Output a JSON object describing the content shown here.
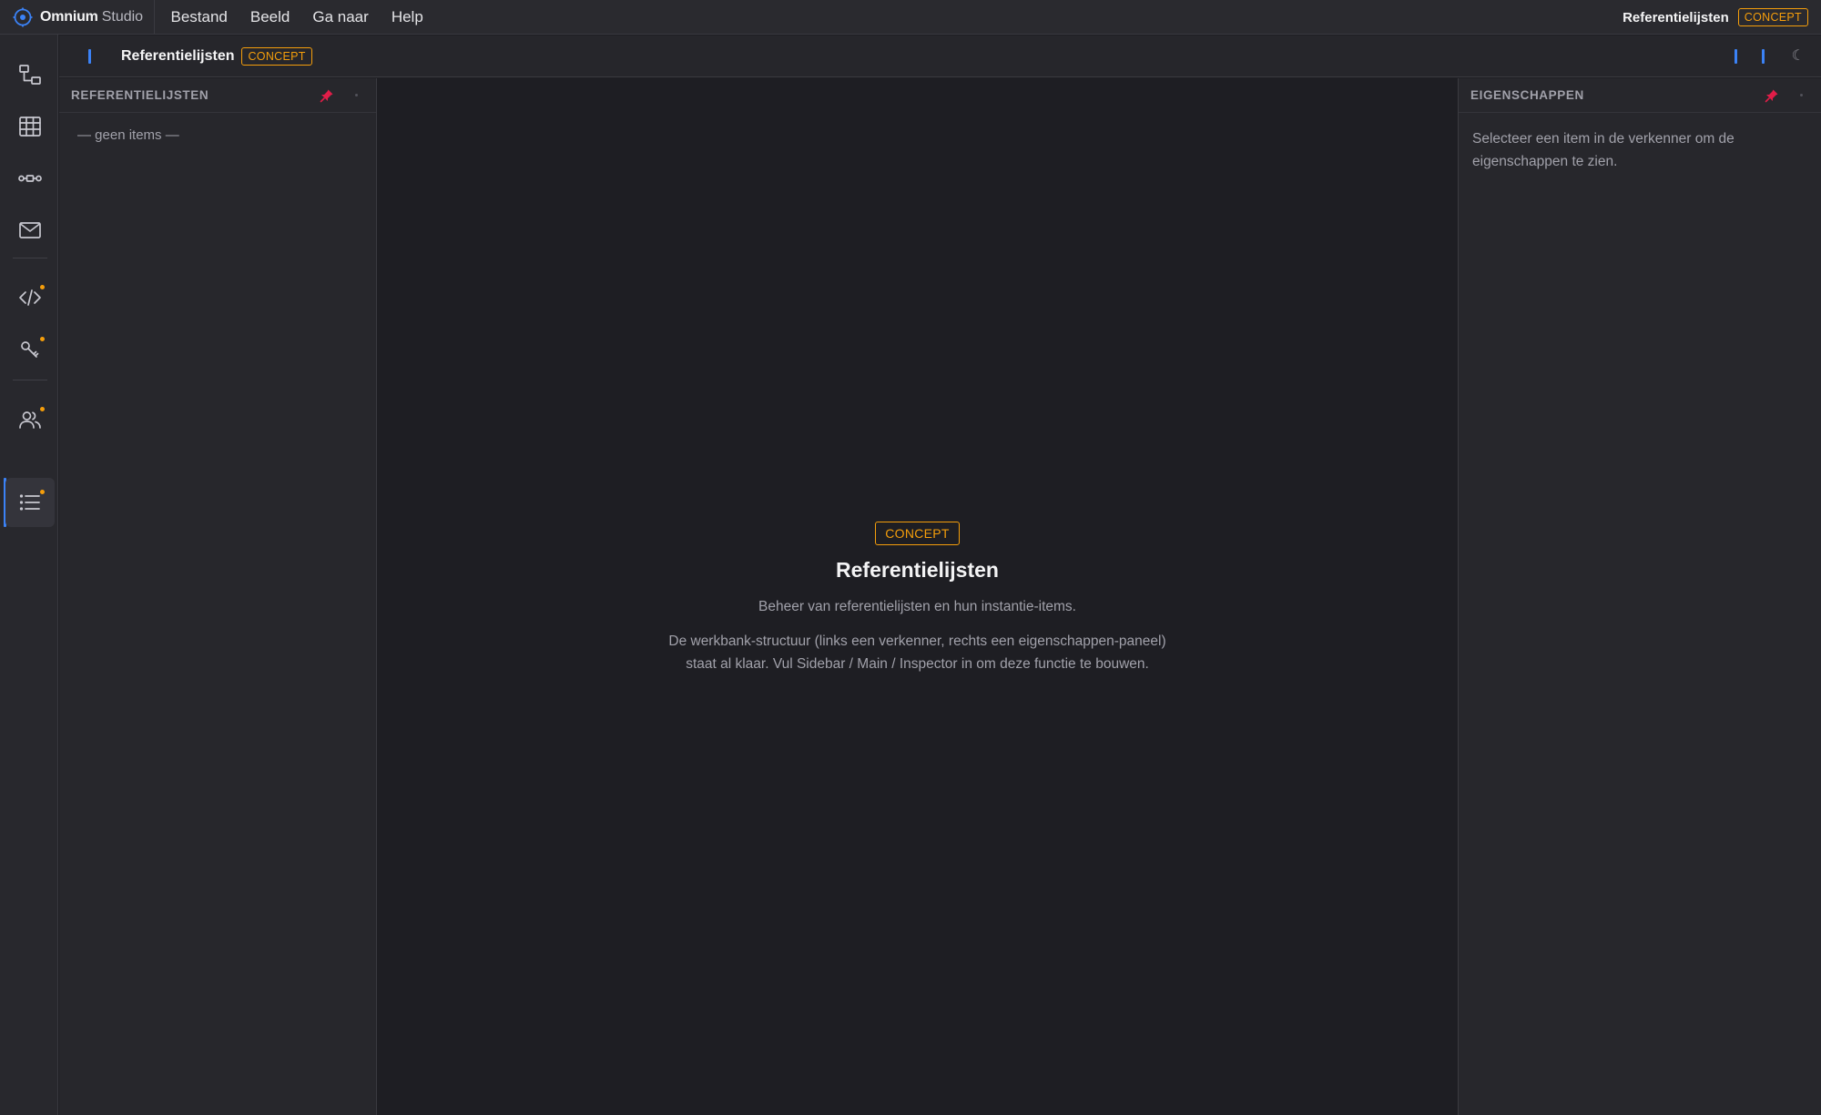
{
  "app": {
    "name": "Omnium",
    "name_suffix": "Studio"
  },
  "menu": {
    "items": [
      {
        "label": "Bestand"
      },
      {
        "label": "Beeld"
      },
      {
        "label": "Ga naar"
      },
      {
        "label": "Help"
      }
    ]
  },
  "titlebar": {
    "document_title": "Referentielijsten",
    "status_badge": "CONCEPT"
  },
  "activity_bar": {
    "items": [
      {
        "icon": "diagram-icon",
        "has_dot": false,
        "active": false
      },
      {
        "icon": "table-icon",
        "has_dot": false,
        "active": false
      },
      {
        "icon": "flow-icon",
        "has_dot": false,
        "active": false
      },
      {
        "icon": "mail-icon",
        "has_dot": false,
        "active": false
      },
      {
        "icon": "code-icon",
        "has_dot": true,
        "active": false
      },
      {
        "icon": "key-icon",
        "has_dot": true,
        "active": false
      },
      {
        "icon": "users-icon",
        "has_dot": true,
        "active": false
      },
      {
        "icon": "list-icon",
        "has_dot": true,
        "active": true
      }
    ],
    "dot_color": "#f59e0b",
    "active_color": "#3b82f6"
  },
  "tab": {
    "title": "Referentielijsten",
    "badge": "CONCEPT"
  },
  "sidebar": {
    "title": "REFERENTIELIJSTEN",
    "empty_text": "— geen items —"
  },
  "main": {
    "badge": "CONCEPT",
    "heading": "Referentielijsten",
    "lead": "Beheer van referentielijsten en hun instantie-items.",
    "description_line1": "De werkbank-structuur (links een verkenner, rechts een eigenschappen-paneel)",
    "description_line2": "staat al klaar. Vul Sidebar / Main / Inspector in om deze functie te bouwen."
  },
  "inspector": {
    "title": "EIGENSCHAPPEN",
    "placeholder": "Selecteer een item in de verkenner om de eigenschappen te zien."
  },
  "colors": {
    "accent_orange": "#f59e0b",
    "accent_blue": "#3b82f6",
    "pin_pink": "#e11d48",
    "background": "#1e1e23",
    "panel": "#27272c"
  }
}
